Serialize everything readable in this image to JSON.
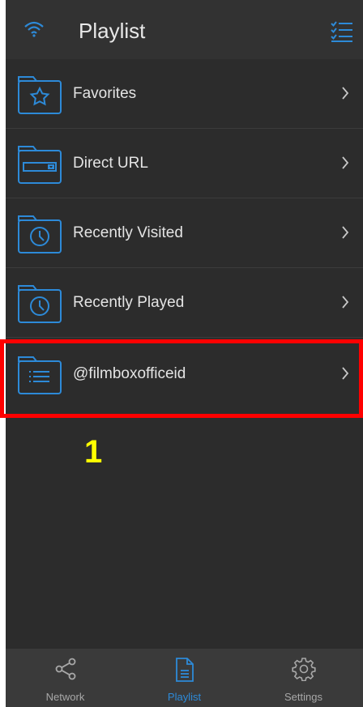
{
  "header": {
    "title": "Playlist",
    "wifi_icon": "wifi-icon",
    "menu_icon": "checklist-icon"
  },
  "rows": [
    {
      "label": "Favorites",
      "icon": "star-folder-icon"
    },
    {
      "label": "Direct URL",
      "icon": "url-folder-icon"
    },
    {
      "label": "Recently Visited",
      "icon": "clock-folder-icon"
    },
    {
      "label": "Recently Played",
      "icon": "clock-folder-icon"
    },
    {
      "label": "@filmboxofficeid",
      "icon": "list-folder-icon"
    }
  ],
  "annotation": {
    "step": "1"
  },
  "tabs": [
    {
      "label": "Network",
      "icon": "share-icon",
      "active": false
    },
    {
      "label": "Playlist",
      "icon": "document-icon",
      "active": true
    },
    {
      "label": "Settings",
      "icon": "gear-icon",
      "active": false
    }
  ],
  "colors": {
    "accent": "#2d8ad8",
    "background": "#2c2c2c",
    "highlight": "#ff0000",
    "annotation": "#ffff00"
  }
}
